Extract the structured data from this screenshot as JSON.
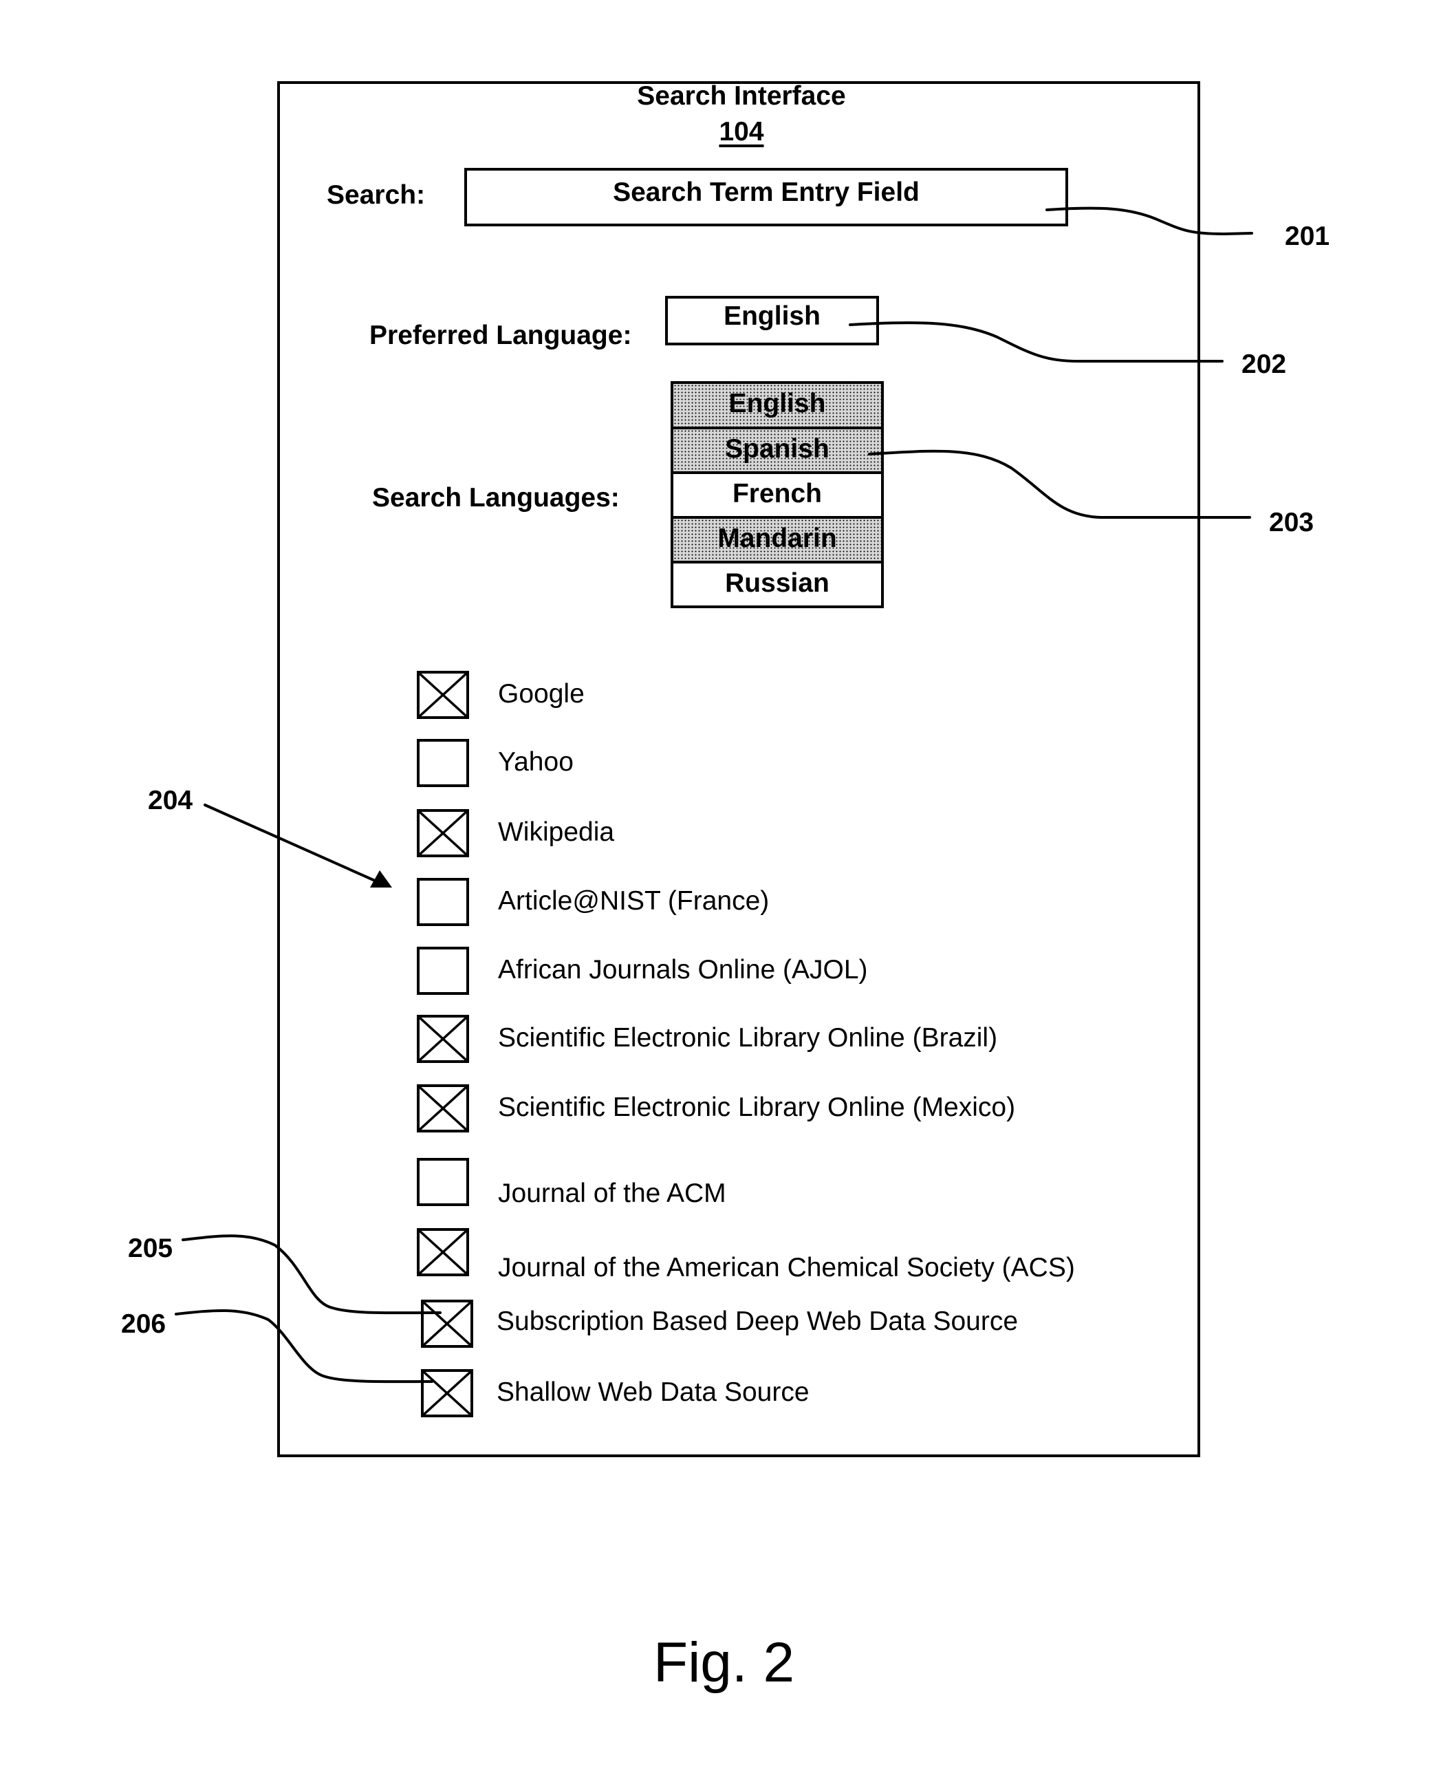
{
  "figure": {
    "caption": "Fig. 2"
  },
  "search_interface": {
    "title": "Search Interface",
    "ref_number": "104",
    "search": {
      "label": "Search:",
      "field_text": "Search Term Entry Field"
    },
    "preferred_language": {
      "label": "Preferred Language:",
      "selected": "English"
    },
    "search_languages": {
      "label": "Search Languages:",
      "options": [
        {
          "label": "English",
          "selected": true
        },
        {
          "label": "Spanish",
          "selected": true
        },
        {
          "label": "French",
          "selected": false
        },
        {
          "label": "Mandarin",
          "selected": true
        },
        {
          "label": "Russian",
          "selected": false
        }
      ]
    },
    "data_sources": [
      {
        "label": "Google",
        "checked": true
      },
      {
        "label": "Yahoo",
        "checked": false
      },
      {
        "label": "Wikipedia",
        "checked": true
      },
      {
        "label": "Article@NIST (France)",
        "checked": false
      },
      {
        "label": "African Journals Online (AJOL)",
        "checked": false
      },
      {
        "label": "Scientific Electronic Library Online (Brazil)",
        "checked": true
      },
      {
        "label": "Scientific Electronic Library Online (Mexico)",
        "checked": true
      },
      {
        "label": "Journal of the ACM",
        "checked": false
      },
      {
        "label": "Journal of the American Chemical Society (ACS)",
        "checked": true
      },
      {
        "label": "Subscription Based Deep Web Data Source",
        "checked": true
      },
      {
        "label": "Shallow Web Data Source",
        "checked": true
      }
    ]
  },
  "callouts": {
    "c201": "201",
    "c202": "202",
    "c203": "203",
    "c204": "204",
    "c205": "205",
    "c206": "206"
  }
}
